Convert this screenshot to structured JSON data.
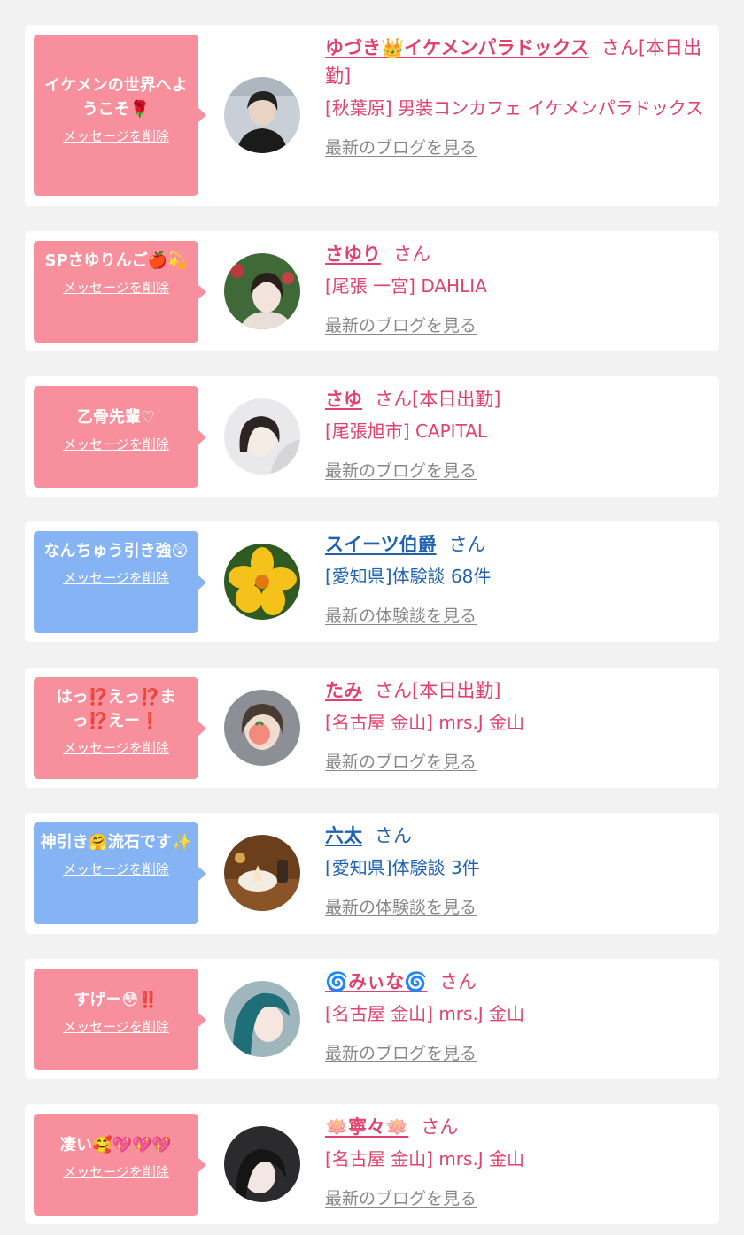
{
  "colors": {
    "page_bg": "#f2f2f2",
    "pink": "#f7909c",
    "blue": "#86b3f3",
    "pink_text": "#e2416d",
    "blue_text": "#1f62b0",
    "gray_link": "#888888"
  },
  "items": [
    {
      "message": "イケメンの世界へようこそ🌹",
      "delete_label": "メッセージを削除",
      "name": "ゆづき👑イケメンパラドックス",
      "suffix": "さん[本日出勤]",
      "shop": "[秋葉原] 男装コンカフェ イケメンパラドックス",
      "latest_label": "最新のブログを見る",
      "color": "pink",
      "avatar": "avatar-photo-man-dark"
    },
    {
      "message": "SPさゆりんご🍎💫",
      "delete_label": "メッセージを削除",
      "name": "さゆり",
      "suffix": "さん",
      "shop": "[尾張 一宮] DAHLIA",
      "latest_label": "最新のブログを見る",
      "color": "pink",
      "avatar": "avatar-photo-girl-garden"
    },
    {
      "message": "乙骨先輩♡",
      "delete_label": "メッセージを削除",
      "name": "さゆ",
      "suffix": "さん[本日出勤]",
      "shop": "[尾張旭市] CAPITAL",
      "latest_label": "最新のブログを見る",
      "color": "pink",
      "avatar": "avatar-photo-girl-light"
    },
    {
      "message": "なんちゅう引き強😲",
      "delete_label": "メッセージを削除",
      "name": "スイーツ伯爵",
      "suffix": "さん",
      "shop": "[愛知県]体験談 68件",
      "latest_label": "最新の体験談を見る",
      "color": "blue",
      "avatar": "avatar-photo-yellow-flower"
    },
    {
      "message": "はっ⁉️えっ⁉️まっ⁉️えー❗️",
      "delete_label": "メッセージを削除",
      "name": "たみ",
      "suffix": "さん[本日出勤]",
      "shop": "[名古屋 金山] mrs.J 金山",
      "latest_label": "最新のブログを見る",
      "color": "pink",
      "avatar": "avatar-photo-girl-peach"
    },
    {
      "message": "神引き🤗流石です✨",
      "delete_label": "メッセージを削除",
      "name": "六太",
      "suffix": "さん",
      "shop": "[愛知県]体験談 3件",
      "latest_label": "最新の体験談を見る",
      "color": "blue",
      "avatar": "avatar-photo-dessert-table"
    },
    {
      "message": "すげー😳‼️",
      "delete_label": "メッセージを削除",
      "name": "🌀みぃな🌀",
      "suffix": "さん",
      "shop": "[名古屋 金山] mrs.J 金山",
      "latest_label": "最新のブログを見る",
      "color": "pink",
      "avatar": "avatar-photo-girl-teal-hair"
    },
    {
      "message": "凄い🥰💖💖💖",
      "delete_label": "メッセージを削除",
      "name": "🪷寧々🪷",
      "suffix": "さん",
      "shop": "[名古屋 金山] mrs.J 金山",
      "latest_label": "最新のブログを見る",
      "color": "pink",
      "avatar": "avatar-photo-girl-dark-hair"
    }
  ]
}
